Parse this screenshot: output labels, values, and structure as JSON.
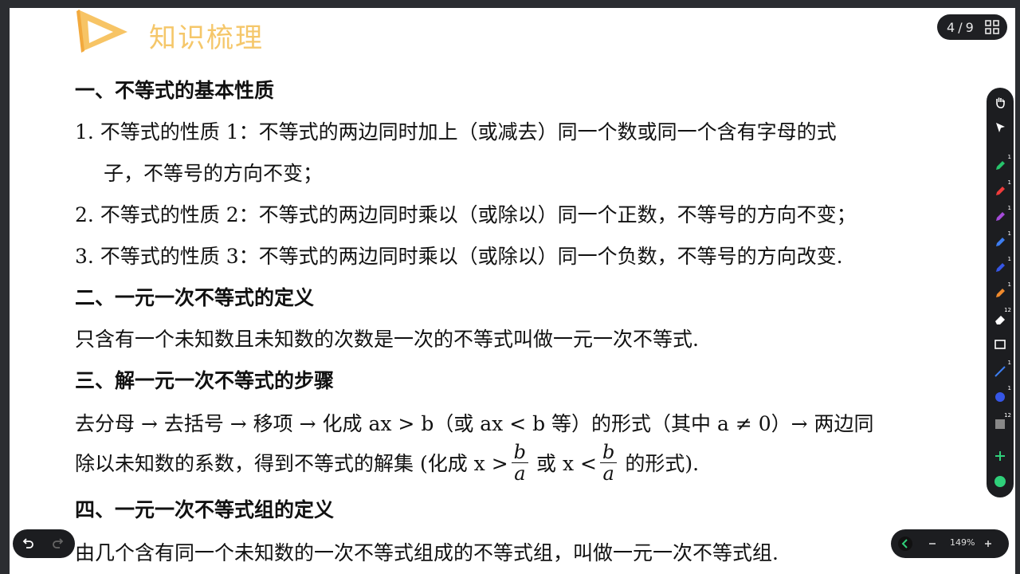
{
  "header": {
    "title": "知识梳理"
  },
  "sections": {
    "s1_title": "一、不等式的基本性质",
    "s1_l1": "1. 不等式的性质 1：不等式的两边同时加上（或减去）同一个数或同一个含有字母的式",
    "s1_l1b": "子，不等号的方向不变；",
    "s1_l2": "2. 不等式的性质 2：不等式的两边同时乘以（或除以）同一个正数，不等号的方向不变；",
    "s1_l3": "3. 不等式的性质 3：不等式的两边同时乘以（或除以）同一个负数，不等号的方向改变.",
    "s2_title": "二、一元一次不等式的定义",
    "s2_l1": "只含有一个未知数且未知数的次数是一次的不等式叫做一元一次不等式.",
    "s3_title": "三、解一元一次不等式的步骤",
    "s3_l1": "去分母 → 去括号 → 移项 → 化成 ax > b（或 ax < b 等）的形式（其中 a ≠ 0）→ 两边同",
    "s3_l2a": "除以未知数的系数，得到不等式的解集 (化成 x >",
    "s3_frac_num": "b",
    "s3_frac_den": "a",
    "s3_l2b": "或 x <",
    "s3_l2c": "的形式).",
    "s4_title": "四、一元一次不等式组的定义",
    "s4_l1": "由几个含有同一个未知数的一次不等式组成的不等式组，叫做一元一次不等式组."
  },
  "pager": {
    "current": "4",
    "sep": "/",
    "total": "9"
  },
  "zoom": {
    "level": "149%"
  },
  "toolbar": {
    "tools": [
      {
        "name": "hand-tool-icon",
        "color": "#ffffff",
        "badge": ""
      },
      {
        "name": "pointer-tool-icon",
        "color": "#ffffff",
        "badge": ""
      },
      {
        "name": "pen-green-icon",
        "color": "#27c46b",
        "badge": "1"
      },
      {
        "name": "pen-red-icon",
        "color": "#ef3b3b",
        "badge": "1"
      },
      {
        "name": "pen-purple-icon",
        "color": "#a54bd9",
        "badge": "1"
      },
      {
        "name": "pen-blue-icon",
        "color": "#3d7df0",
        "badge": "1"
      },
      {
        "name": "pen-darkblue-icon",
        "color": "#3656e6",
        "badge": "1"
      },
      {
        "name": "pen-orange-icon",
        "color": "#f08a2c",
        "badge": "1"
      },
      {
        "name": "eraser-icon",
        "color": "#ffffff",
        "badge": "12"
      },
      {
        "name": "image-icon",
        "color": "#ffffff",
        "badge": ""
      },
      {
        "name": "line-tool-icon",
        "color": "#3d7df0",
        "badge": "1"
      },
      {
        "name": "shape-tool-icon",
        "color": "#3656e6",
        "badge": "1"
      },
      {
        "name": "calendar-icon",
        "color": "#888888",
        "badge": "12"
      },
      {
        "name": "add-icon",
        "color": "#2fd07a",
        "badge": ""
      },
      {
        "name": "exit-icon",
        "color": "#2fd07a",
        "badge": ""
      }
    ]
  }
}
